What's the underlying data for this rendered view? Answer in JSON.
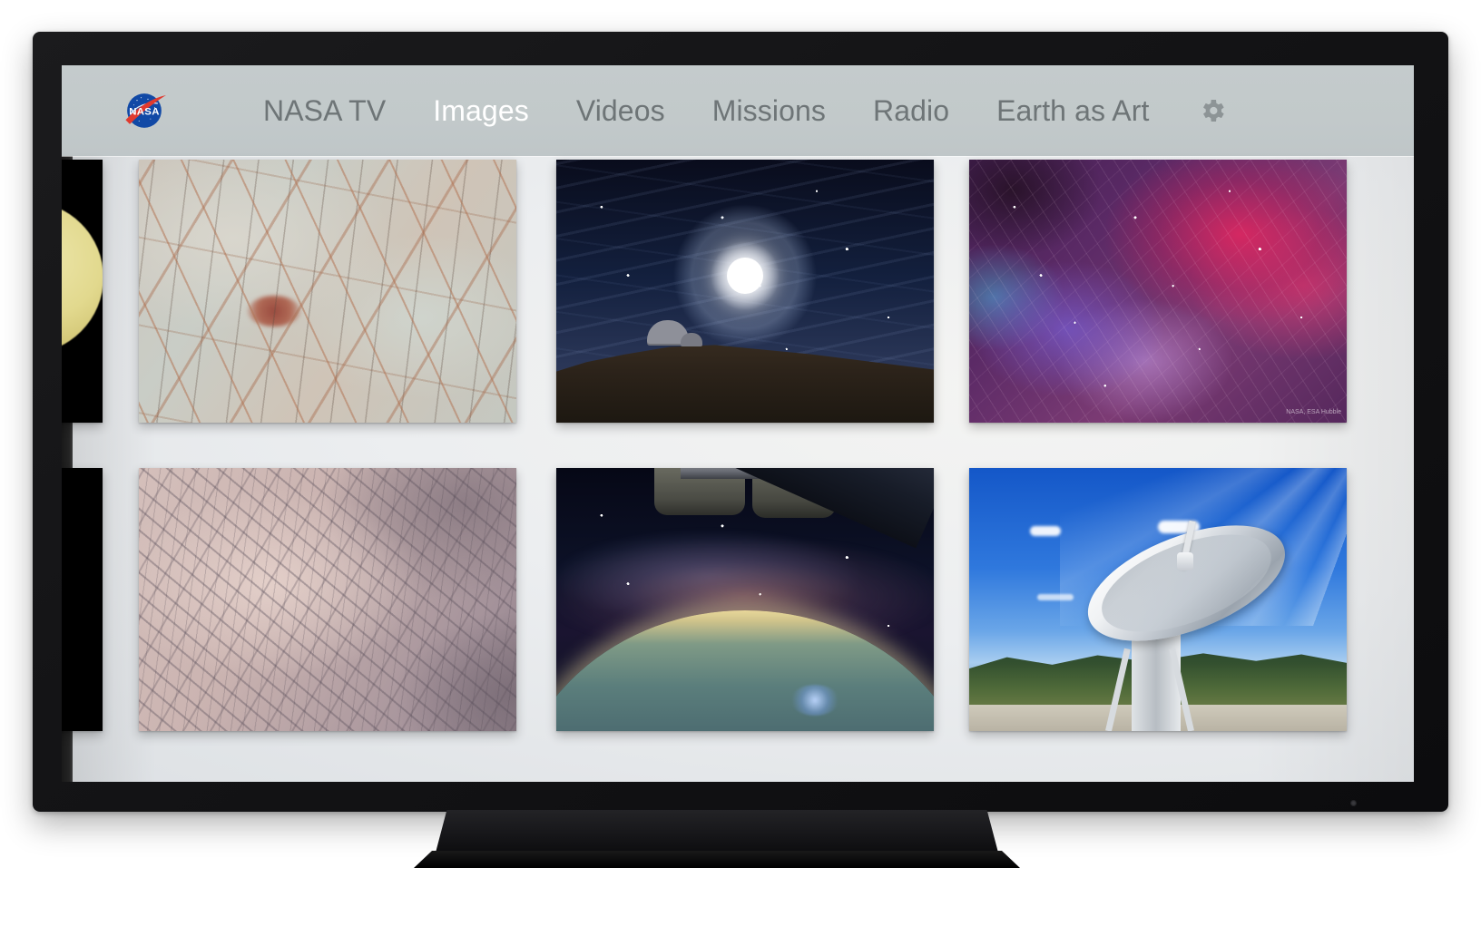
{
  "device": {
    "type": "television",
    "ir_indicator": "power-led"
  },
  "app": {
    "name": "NASA",
    "logo_text": "NASA",
    "logo_colors": {
      "blue": "#1149a6",
      "red": "#e03a2f",
      "white": "#ffffff"
    }
  },
  "nav": {
    "active_item": "Images",
    "active_color": "#ffffff",
    "inactive_color": "#6e7577",
    "bar_color": "#c2c9ca",
    "items": [
      {
        "label": "NASA TV",
        "active": false
      },
      {
        "label": "Images",
        "active": true
      },
      {
        "label": "Videos",
        "active": false
      },
      {
        "label": "Missions",
        "active": false
      },
      {
        "label": "Radio",
        "active": false
      },
      {
        "label": "Earth as Art",
        "active": false
      }
    ],
    "settings": {
      "icon": "gear-icon",
      "label": "Settings"
    }
  },
  "grid": {
    "columns": 3,
    "rows": 2,
    "rows_data": [
      {
        "row_index": 1,
        "tiles": [
          {
            "position": "partial-left",
            "subject": "Yellow planet disc on black background",
            "art": "art-venus"
          },
          {
            "position": "col-1",
            "subject": "Europa icy cracked surface with reddish linea",
            "art": "art-europa"
          },
          {
            "position": "col-2",
            "subject": "Lunar halo over mountaintop observatory at night",
            "art": "art-halo"
          },
          {
            "position": "col-3",
            "subject": "Pink and blue nebula in visible light",
            "art": "art-nebula",
            "credit": "NASA, ESA\nHubble"
          }
        ]
      },
      {
        "row_index": 2,
        "tiles": [
          {
            "position": "partial-left",
            "subject": "Black tile edge",
            "art": "art-black"
          },
          {
            "position": "col-1",
            "subject": "Earth as Art river canyon terrain from orbit",
            "art": "art-terrain"
          },
          {
            "position": "col-2",
            "subject": "Milky Way and Earth limb seen from space station cupola",
            "art": "art-iss"
          },
          {
            "position": "col-3",
            "subject": "Deep Space Network radio telescope dish under blue sky",
            "art": "art-dish"
          }
        ]
      }
    ]
  }
}
